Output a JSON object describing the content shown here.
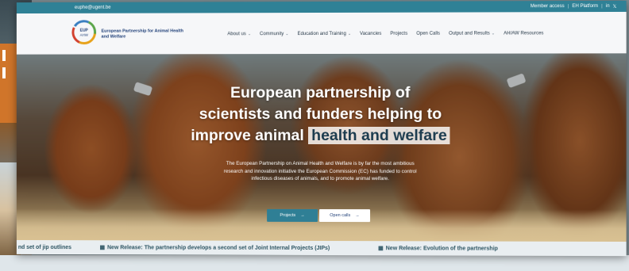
{
  "topbar": {
    "email": "euphe@ugent.be",
    "member_access": "Member access",
    "platforms": "EH Platform",
    "lang": "in",
    "twitter_glyph": "𝕏",
    "separator": "|"
  },
  "brand": {
    "logo_text": "EUP AHW",
    "name": "European Partnership for Animal Health and Welfare"
  },
  "menu": [
    {
      "label": "About us",
      "has_dropdown": true
    },
    {
      "label": "Community",
      "has_dropdown": true
    },
    {
      "label": "Education and Training",
      "has_dropdown": true
    },
    {
      "label": "Vacancies",
      "has_dropdown": false
    },
    {
      "label": "Projects",
      "has_dropdown": false
    },
    {
      "label": "Open Calls",
      "has_dropdown": false
    },
    {
      "label": "Output and Results",
      "has_dropdown": true
    },
    {
      "label": "AH/AW Resources",
      "has_dropdown": false
    }
  ],
  "hero": {
    "headline_line1": "European partnership of",
    "headline_line2": "scientists and funders helping to",
    "headline_line3_prefix": "improve animal ",
    "headline_highlight": "health and welfare",
    "intro": "The European Partnership on Animal Health and Welfare is by far the most ambitious research and innovation initiative the European Commission (EC) has funded to control infectious diseases of animals, and to promote animal welfare.",
    "button_projects": "Projects",
    "button_open_calls": "Open calls",
    "arrow_glyph": "→"
  },
  "ticker": {
    "item1": "nd set of jip outlines",
    "item2": "New Release: The partnership develops a second set of Joint Internal Projects (JIPs)",
    "item3": "New Release: Evolution of the partnership"
  },
  "colors": {
    "topbar": "#2f8196",
    "brand_blue": "#1f3f78",
    "button_teal": "#2f7f95",
    "highlight_text": "#1d3c4f"
  }
}
